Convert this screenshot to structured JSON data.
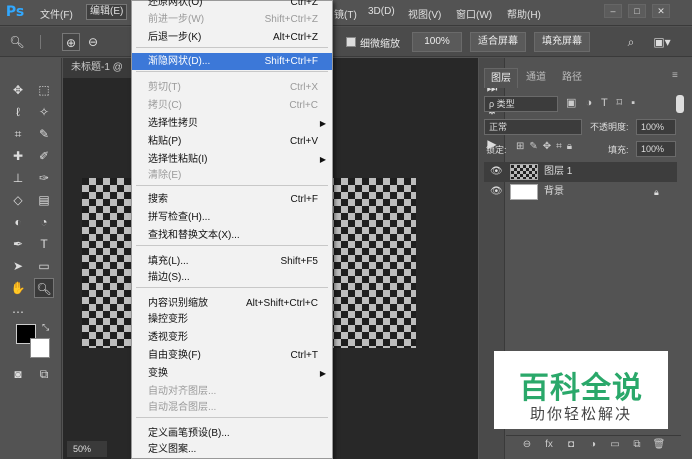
{
  "app": {
    "logo": "Ps"
  },
  "menubar": {
    "items": [
      "文件(F)",
      "编辑(E)",
      "镜(T)",
      "3D(D)",
      "视图(V)",
      "窗口(W)",
      "帮助(H)"
    ]
  },
  "window_controls": {
    "minimize": "–",
    "maximize": "□",
    "close": "✕"
  },
  "options": {
    "zoom_all_windows": "细微缩放",
    "zoom_percent": "100%",
    "fit_screen": "适合屏幕",
    "fill_screen": "填充屏幕"
  },
  "document": {
    "tab_title": "未标题-1 @",
    "zoom": "50%"
  },
  "edit_menu": {
    "top_partial": "还原网状(O)",
    "top_partial_shortcut": "Ctrl+Z",
    "items": [
      {
        "label": "前进一步(W)",
        "shortcut": "Shift+Ctrl+Z",
        "disabled": true
      },
      {
        "label": "后退一步(K)",
        "shortcut": "Alt+Ctrl+Z"
      },
      {
        "label": "渐隐网状(D)...",
        "shortcut": "Shift+Ctrl+F",
        "highlighted": true
      },
      {
        "label": "剪切(T)",
        "shortcut": "Ctrl+X",
        "disabled": true
      },
      {
        "label": "拷贝(C)",
        "shortcut": "Ctrl+C",
        "disabled": true
      },
      {
        "label": "选择性拷贝",
        "submenu": true
      },
      {
        "label": "粘贴(P)",
        "shortcut": "Ctrl+V"
      },
      {
        "label": "选择性粘贴(I)",
        "submenu": true
      },
      {
        "label": "清除(E)",
        "disabled": true
      },
      {
        "label": "搜索",
        "shortcut": "Ctrl+F"
      },
      {
        "label": "拼写检查(H)..."
      },
      {
        "label": "查找和替换文本(X)..."
      },
      {
        "label": "填充(L)...",
        "shortcut": "Shift+F5"
      },
      {
        "label": "描边(S)..."
      },
      {
        "label": "内容识别缩放",
        "shortcut": "Alt+Shift+Ctrl+C"
      },
      {
        "label": "操控变形"
      },
      {
        "label": "透视变形"
      },
      {
        "label": "自由变换(F)",
        "shortcut": "Ctrl+T"
      },
      {
        "label": "变换",
        "submenu": true
      },
      {
        "label": "自动对齐图层...",
        "disabled": true
      },
      {
        "label": "自动混合图层...",
        "disabled": true
      },
      {
        "label": "定义画笔预设(B)..."
      },
      {
        "label": "定义图案..."
      }
    ]
  },
  "panels": {
    "tabs": [
      "图层",
      "通道",
      "路径"
    ],
    "filter_kind": "ρ 类型",
    "blend_mode": "正常",
    "opacity_label": "不透明度:",
    "opacity_value": "100%",
    "lock_label": "锁定:",
    "fill_label": "填充:",
    "fill_value": "100%",
    "layers": [
      {
        "name": "图层 1",
        "selected": true
      },
      {
        "name": "背景",
        "locked": true
      }
    ]
  },
  "watermark": {
    "title": "百科全说",
    "subtitle": "助你轻松解决"
  },
  "colors": {
    "accent": "#3c78d8",
    "watermark_green": "#2aa86a"
  }
}
